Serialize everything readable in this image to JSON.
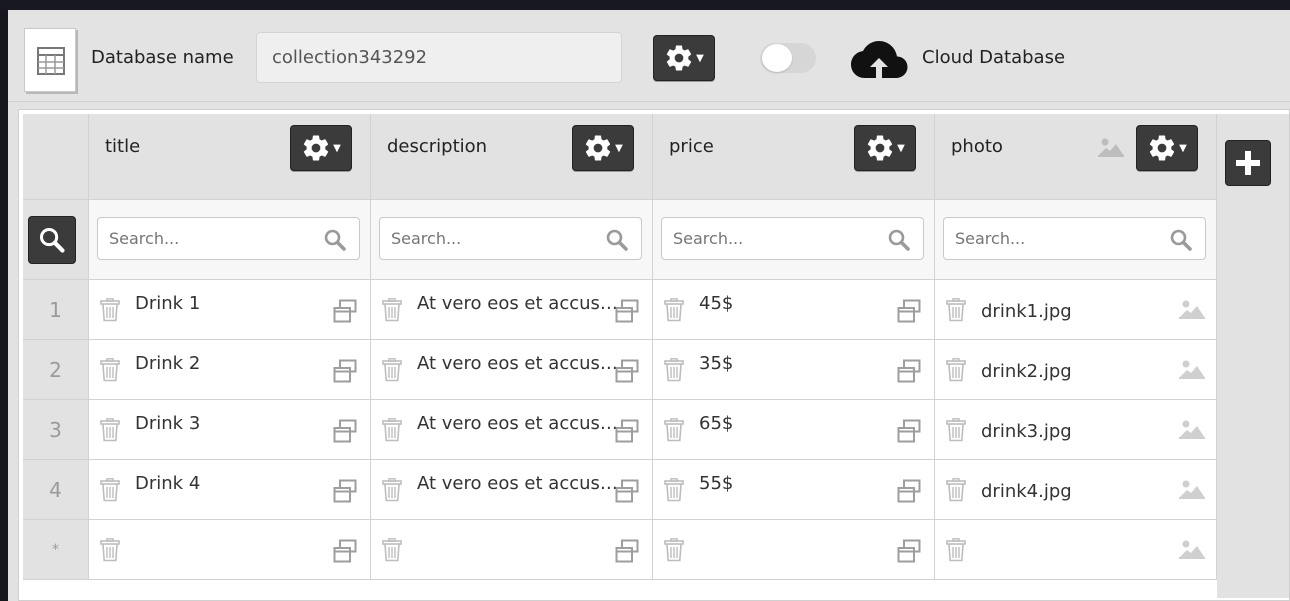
{
  "header": {
    "db_label": "Database name",
    "db_value": "collection343292",
    "cloud_label": "Cloud Database",
    "cloud_toggle_on": false
  },
  "columns": [
    {
      "key": "title",
      "label": "title",
      "has_image_icon": false
    },
    {
      "key": "description",
      "label": "description",
      "has_image_icon": false
    },
    {
      "key": "price",
      "label": "price",
      "has_image_icon": false
    },
    {
      "key": "photo",
      "label": "photo",
      "has_image_icon": true
    }
  ],
  "search_placeholder": "Search...",
  "rows": [
    {
      "num": "1",
      "title": "Drink 1",
      "description": "At vero eos et accus…",
      "price": "45$",
      "photo": "drink1.jpg"
    },
    {
      "num": "2",
      "title": "Drink 2",
      "description": "At vero eos et accus…",
      "price": "35$",
      "photo": "drink2.jpg"
    },
    {
      "num": "3",
      "title": "Drink 3",
      "description": "At vero eos et accus…",
      "price": "65$",
      "photo": "drink3.jpg"
    },
    {
      "num": "4",
      "title": "Drink 4",
      "description": "At vero eos et accus…",
      "price": "55$",
      "photo": "drink4.jpg"
    },
    {
      "num": "*",
      "title": "",
      "description": "",
      "price": "",
      "photo": ""
    }
  ],
  "icons": {
    "db": "table-icon",
    "settings": "gear-icon",
    "cloud": "cloud-upload-icon",
    "search": "search-icon",
    "delete": "trash-icon",
    "expand": "copy-icon",
    "image": "image-icon",
    "add": "plus-icon"
  },
  "colors": {
    "button_dark": "#3b3b3b",
    "header_bg": "#e2e2e2",
    "text": "#222222"
  }
}
